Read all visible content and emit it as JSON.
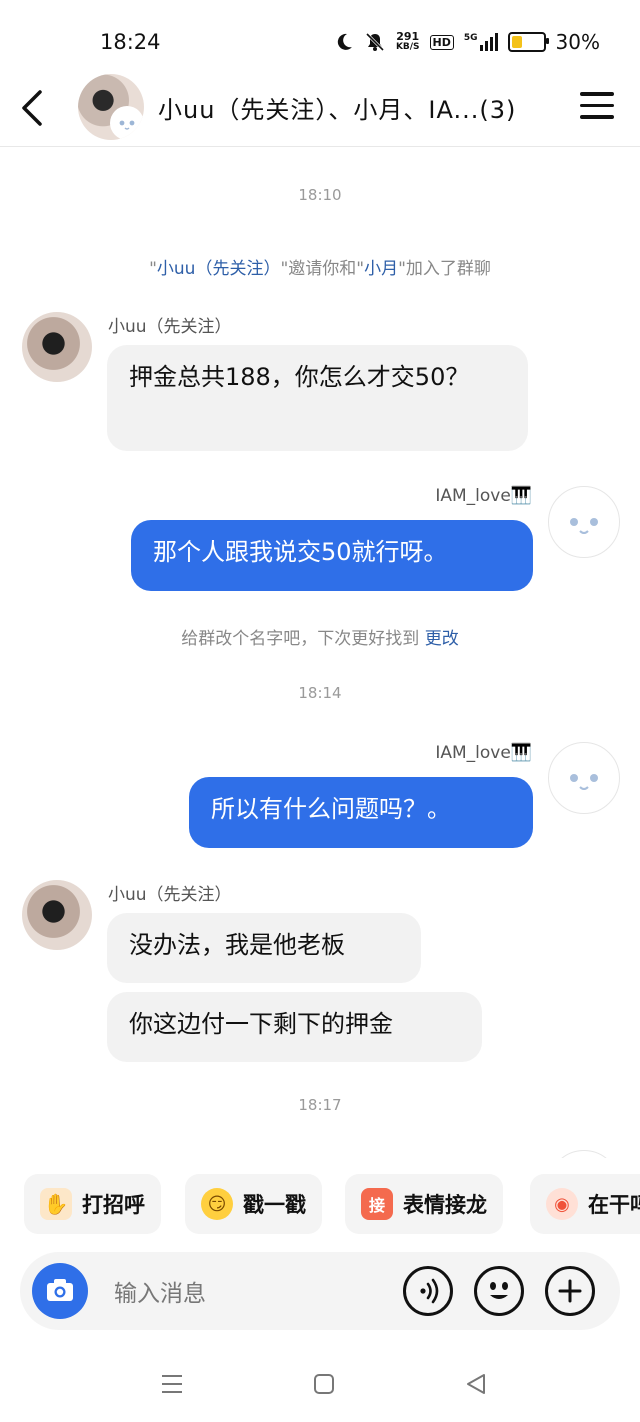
{
  "status_bar": {
    "time": "18:24",
    "net_speed_value": "291",
    "net_speed_unit": "KB/S",
    "hd_label": "HD",
    "signal_label": "5G",
    "battery_percent_text": "30%",
    "battery_level": 0.3
  },
  "header": {
    "title": "小uu（先关注）、小月、IA...(3)"
  },
  "chat": {
    "timestamps": [
      "18:10",
      "18:14",
      "18:17"
    ],
    "invite_notice": {
      "q1": "\"",
      "inviter": "小uu（先关注）",
      "mid": "\"邀请你和\"",
      "invitee": "小月",
      "end": "\"加入了群聊"
    },
    "rename_notice": {
      "text": "给群改个名字吧，下次更好找到 ",
      "link": "更改"
    },
    "messages": [
      {
        "sender": "小uu（先关注）",
        "text": "押金总共188，你怎么才交50？"
      },
      {
        "sender": "IAM_love🎹",
        "text": "那个人跟我说交50就行呀。"
      },
      {
        "sender": "IAM_love🎹",
        "text": "所以有什么问题吗？。"
      },
      {
        "sender": "小uu（先关注）",
        "text": "没办法，我是他老板"
      },
      {
        "sender": "小uu（先关注）",
        "text": "你这边付一下剩下的押金"
      }
    ]
  },
  "quick_actions": [
    {
      "label": "打招呼",
      "icon": "wave-hand-icon"
    },
    {
      "label": "戳一戳",
      "icon": "poke-face-icon"
    },
    {
      "label": "表情接龙",
      "icon_text": "接",
      "icon": "sticker-relay-icon"
    },
    {
      "label": "在干吗",
      "icon": "camera-film-icon"
    }
  ],
  "input_bar": {
    "placeholder": "输入消息"
  },
  "colors": {
    "accent": "#2f6fe8",
    "link": "#2e5fa8",
    "incoming_bubble": "#f2f2f2"
  }
}
